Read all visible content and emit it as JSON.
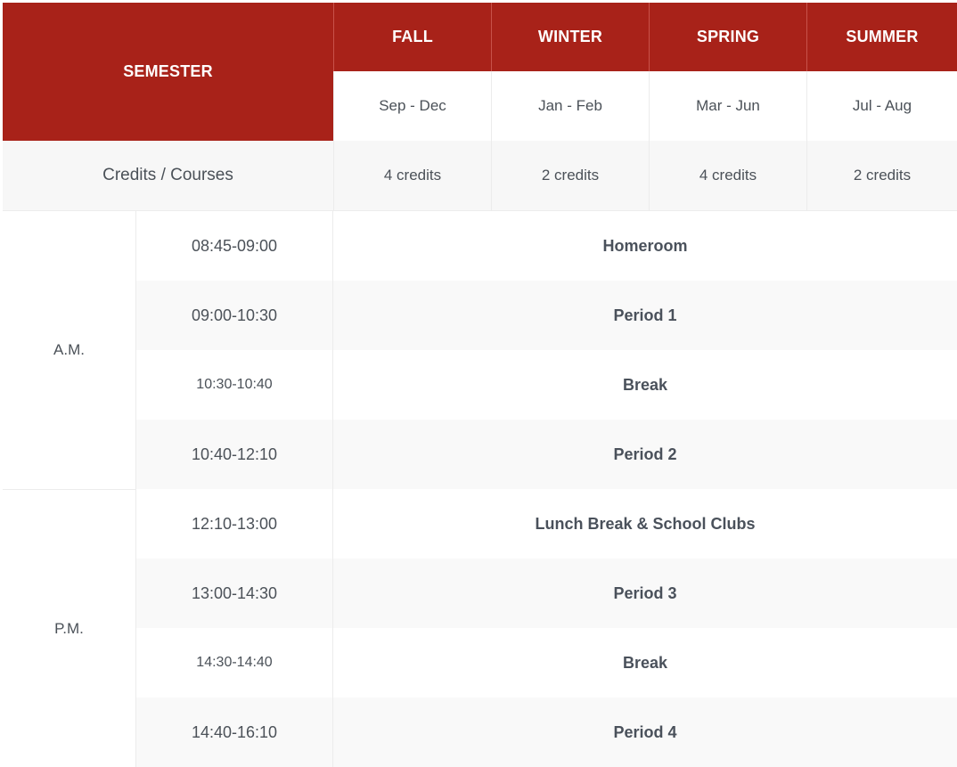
{
  "header": {
    "semester_label": "SEMESTER",
    "seasons": [
      {
        "name": "FALL",
        "range": "Sep - Dec",
        "credits": "4 credits"
      },
      {
        "name": "WINTER",
        "range": "Jan - Feb",
        "credits": "2 credits"
      },
      {
        "name": "SPRING",
        "range": "Mar - Jun",
        "credits": "4 credits"
      },
      {
        "name": "SUMMER",
        "range": "Jul - Aug",
        "credits": "2 credits"
      }
    ],
    "credits_label": "Credits / Courses"
  },
  "schedule": {
    "am_label": "A.M.",
    "pm_label": "P.M.",
    "rows": [
      {
        "time": "08:45-09:00",
        "activity": "Homeroom"
      },
      {
        "time": "09:00-10:30",
        "activity": "Period 1"
      },
      {
        "time": "10:30-10:40",
        "activity": "Break"
      },
      {
        "time": "10:40-12:10",
        "activity": "Period 2"
      },
      {
        "time": "12:10-13:00",
        "activity": "Lunch Break & School Clubs"
      },
      {
        "time": "13:00-14:30",
        "activity": "Period 3"
      },
      {
        "time": "14:30-14:40",
        "activity": "Break"
      },
      {
        "time": "14:40-16:10",
        "activity": "Period 4"
      }
    ]
  },
  "colors": {
    "header_red": "#a82219",
    "header_text": "#ffffff",
    "body_text": "#4b5158",
    "row_alt": "#f9f9f9"
  }
}
